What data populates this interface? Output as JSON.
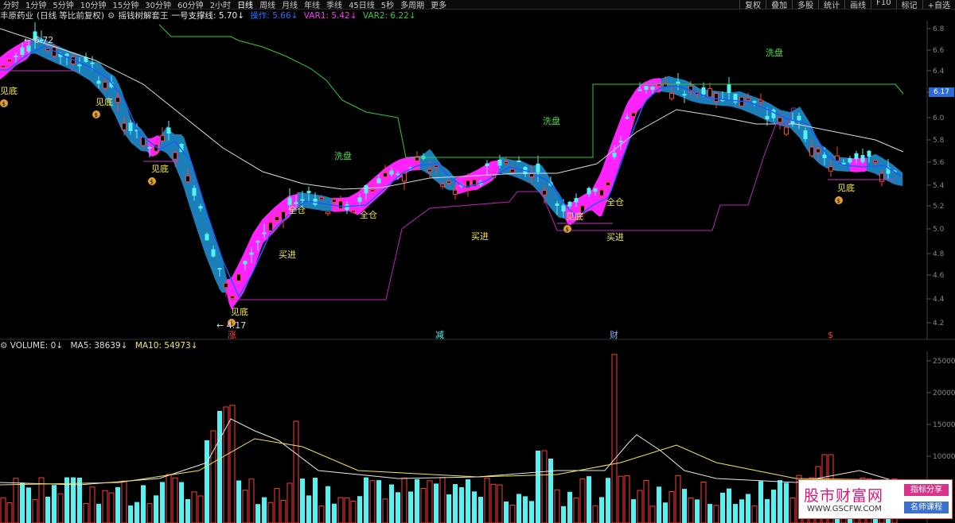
{
  "toolbar": {
    "periods": [
      "分时",
      "1分钟",
      "5分钟",
      "10分钟",
      "15分钟",
      "30分钟",
      "60分钟",
      "2小时",
      "日线",
      "周线",
      "月线",
      "年线",
      "季线",
      "45日线",
      "5秒",
      "多周期",
      "更多"
    ],
    "active": "日线",
    "right": [
      "复权",
      "叠加",
      "多股",
      "统计",
      "画线",
      "F10",
      "标记",
      "+自选"
    ]
  },
  "title": {
    "stock": "丰原药业",
    "mode": "(日线 等比前复权)",
    "indicator": "摇钱树解套王",
    "support": "一号支撑线: 5.70",
    "op": "操作: 5.66",
    "var1": "VAR1: 5.42",
    "var2": "VAR2: 6.22"
  },
  "price_axis": [
    "6.8",
    "6.6",
    "6.4",
    "6.2",
    "6.0",
    "5.8",
    "5.6",
    "5.4",
    "5.2",
    "5.0",
    "4.8",
    "4.6",
    "4.4",
    "4.2"
  ],
  "current_price": "6.17",
  "annotations": {
    "high_mark": "6.72",
    "low_mark": "4.17",
    "jiandi": "见底",
    "quancang": "全仓",
    "mairu": "买进",
    "xipan": "洗盘",
    "event_zhang": "涨",
    "event_jian": "减",
    "event_cai": "财",
    "event_s": "$"
  },
  "volume": {
    "label": "VOLUME: 0",
    "ma5": "MA5: 38639",
    "ma10": "MA10: 54973",
    "axis": [
      "25000",
      "20000",
      "15000",
      "10000"
    ]
  },
  "watermark": {
    "name": "股市财富网",
    "url": "WWW.GSCFW.COM",
    "tag1": "指标分享",
    "tag2": "名师课程"
  },
  "colors": {
    "up": "#ff3b3b",
    "down": "#54f2f2",
    "magenta": "#ff22ff",
    "teal": "#1d7fb8",
    "blue": "#1a5dff",
    "ma_white": "#dcdcdc",
    "green": "#2ecc40",
    "purple": "#c020c0",
    "yellow": "#f4e84a"
  }
}
